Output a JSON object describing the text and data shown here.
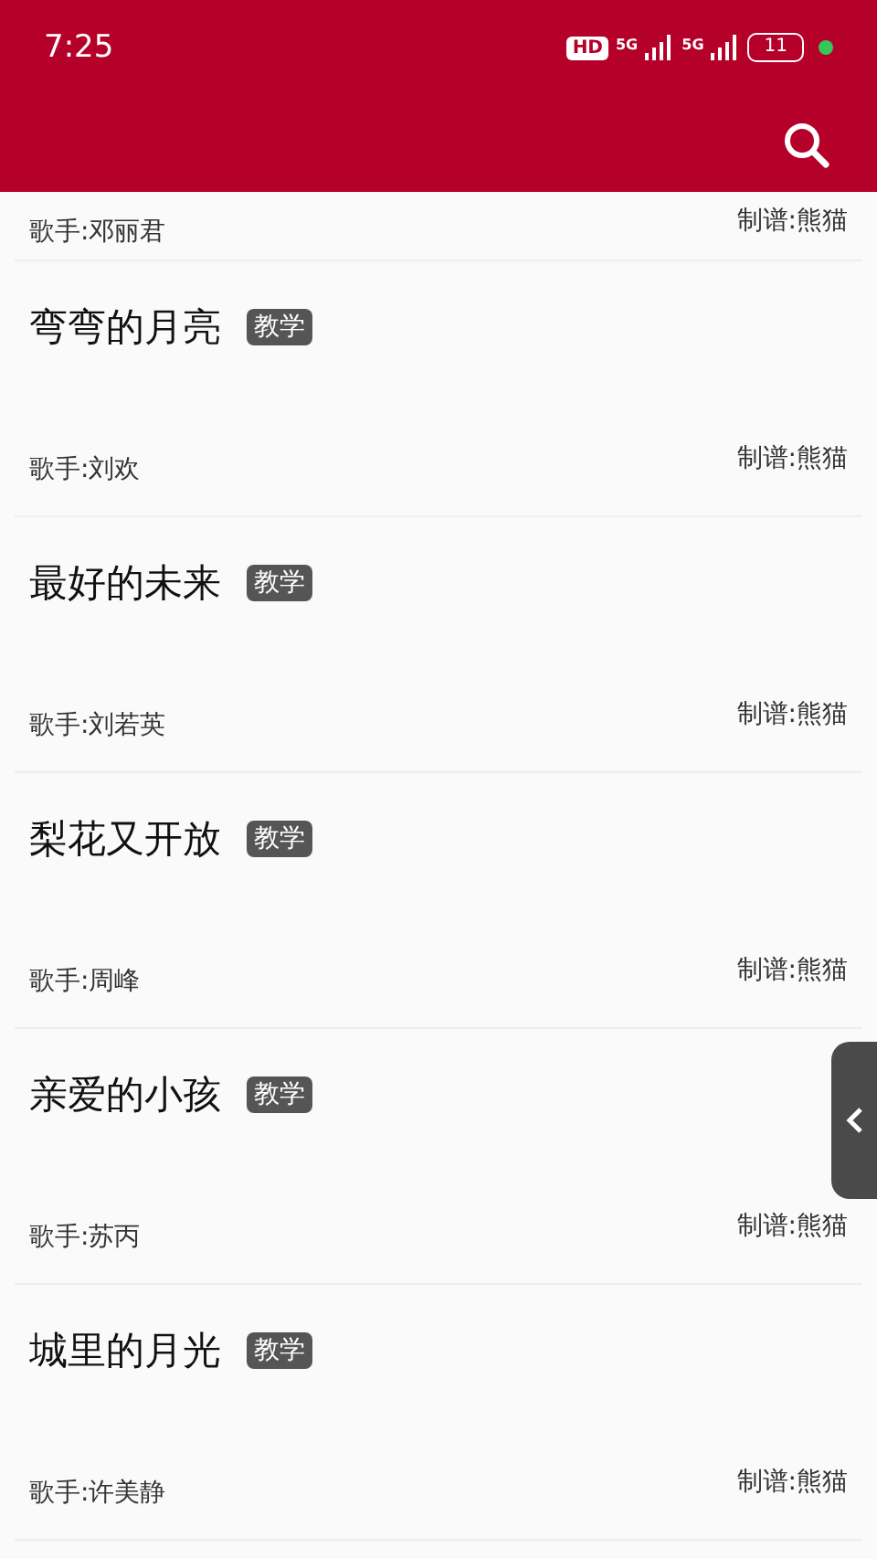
{
  "status_bar": {
    "time": "7:25",
    "hd_badge": "HD",
    "network_1": "5G",
    "network_2": "5G",
    "battery": "11"
  },
  "songs": [
    {
      "singer": "歌手:邓丽君",
      "composer": "制谱:熊猫"
    },
    {
      "title": "弯弯的月亮",
      "tag": "教学",
      "singer": "歌手:刘欢",
      "composer": "制谱:熊猫"
    },
    {
      "title": "最好的未来",
      "tag": "教学",
      "singer": "歌手:刘若英",
      "composer": "制谱:熊猫"
    },
    {
      "title": "梨花又开放",
      "tag": "教学",
      "singer": "歌手:周峰",
      "composer": "制谱:熊猫"
    },
    {
      "title": "亲爱的小孩",
      "tag": "教学",
      "singer": "歌手:苏丙",
      "composer": "制谱:熊猫"
    },
    {
      "title": "城里的月光",
      "tag": "教学",
      "singer": "歌手:许美静",
      "composer": "制谱:熊猫"
    }
  ]
}
